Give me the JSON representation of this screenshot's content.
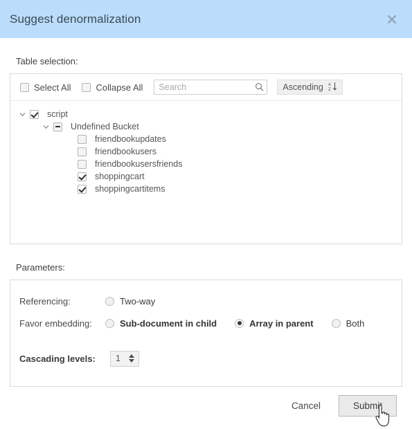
{
  "dialog": {
    "title": "Suggest denormalization",
    "close_icon": "close-icon"
  },
  "table_selection": {
    "section_label": "Table selection:",
    "toolbar": {
      "select_all_label": "Select All",
      "select_all_checked": false,
      "collapse_all_label": "Collapse All",
      "collapse_all_checked": false,
      "search_placeholder": "Search",
      "search_value": "",
      "search_icon": "search-icon",
      "sort_label": "Ascending",
      "sort_icon": "sort-az-descending-icon"
    },
    "tree": [
      {
        "level": 1,
        "label": "script",
        "state": "checked",
        "expanded": true,
        "has_chevron": true
      },
      {
        "level": 2,
        "label": "Undefined Bucket",
        "state": "indeterminate",
        "expanded": true,
        "has_chevron": true
      },
      {
        "level": 3,
        "label": "friendbookupdates",
        "state": "unchecked",
        "has_chevron": false
      },
      {
        "level": 3,
        "label": "friendbookusers",
        "state": "unchecked",
        "has_chevron": false
      },
      {
        "level": 3,
        "label": "friendbookusersfriends",
        "state": "unchecked",
        "has_chevron": false
      },
      {
        "level": 3,
        "label": "shoppingcart",
        "state": "checked",
        "has_chevron": false
      },
      {
        "level": 3,
        "label": "shoppingcartitems",
        "state": "checked",
        "has_chevron": false
      }
    ]
  },
  "parameters": {
    "section_label": "Parameters:",
    "referencing": {
      "label": "Referencing:",
      "options": [
        {
          "label": "Two-way",
          "selected": false,
          "bold": false
        }
      ]
    },
    "favor_embedding": {
      "label": "Favor embedding:",
      "options": [
        {
          "label": "Sub-document in child",
          "selected": false,
          "bold": true
        },
        {
          "label": "Array in parent",
          "selected": true,
          "bold": true
        },
        {
          "label": "Both",
          "selected": false,
          "bold": false
        }
      ]
    },
    "cascading_levels": {
      "label": "Cascading levels:",
      "value": "1"
    }
  },
  "footer": {
    "cancel_label": "Cancel",
    "submit_label": "Submit"
  },
  "colors": {
    "header_background": "#b9ddfb",
    "panel_border": "#dcdcdc",
    "text": "#4a4a4a",
    "button_background": "#eaeaea"
  }
}
